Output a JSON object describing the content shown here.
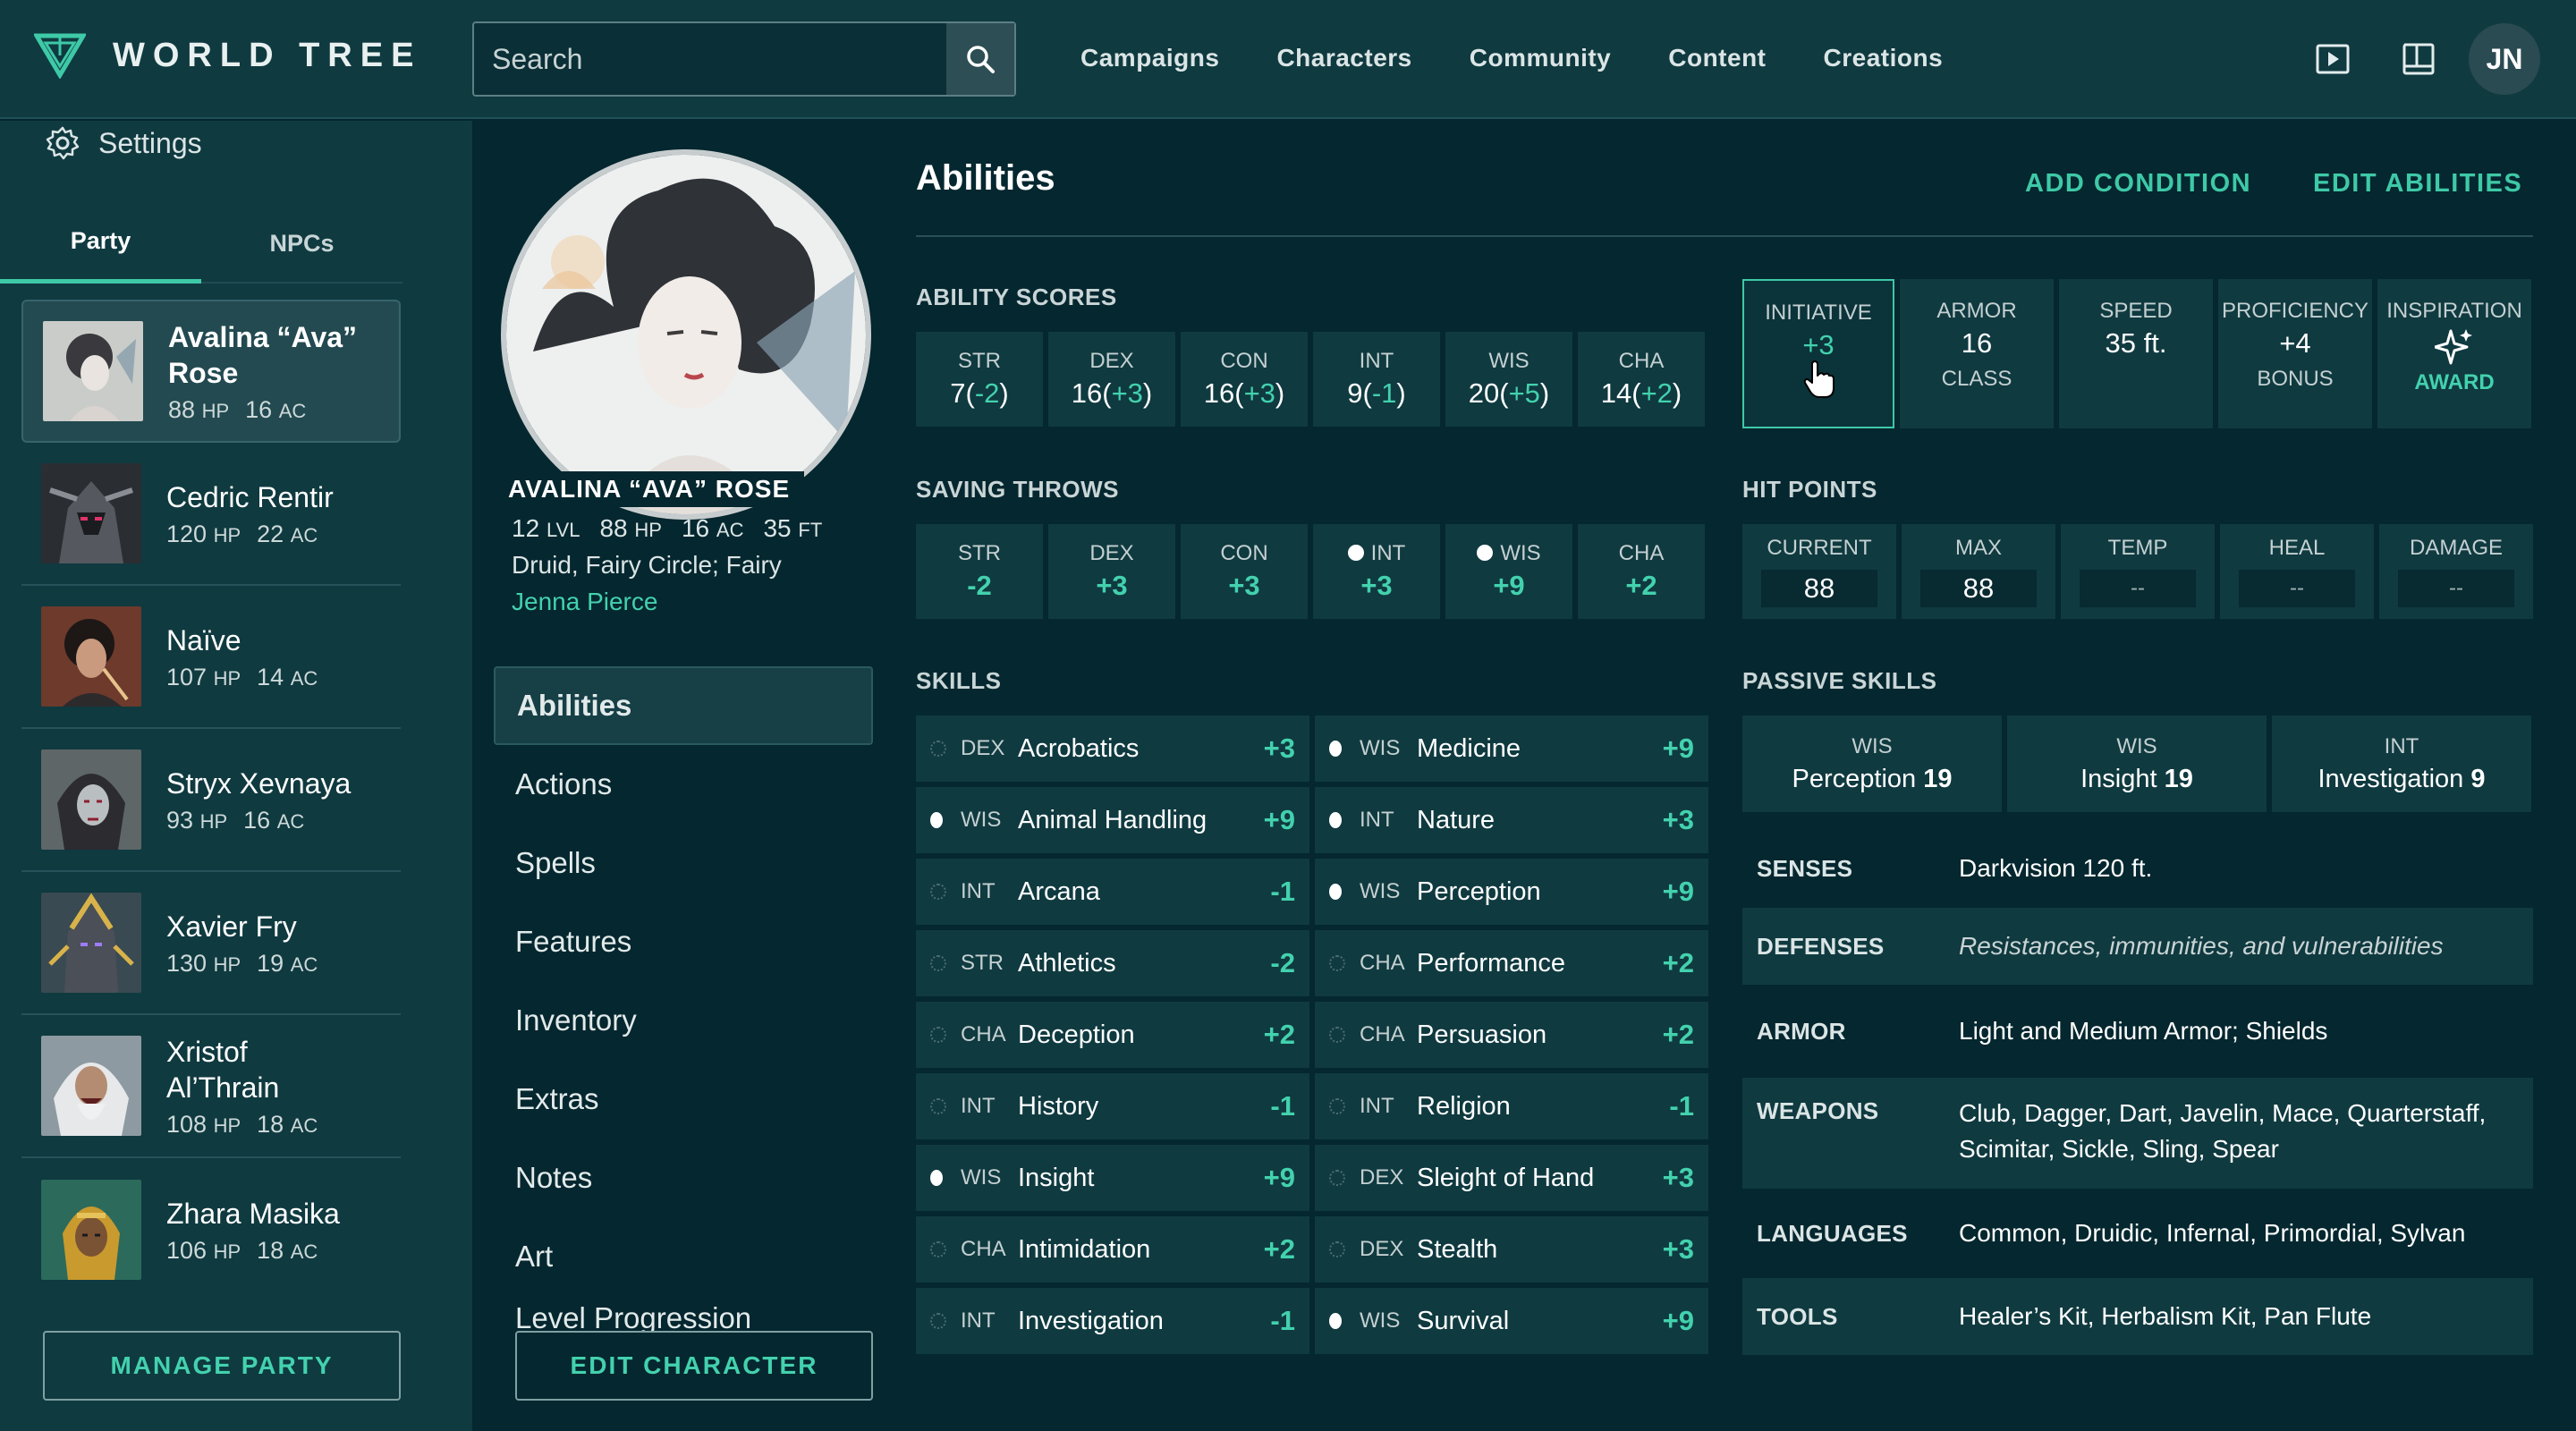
{
  "app": {
    "name": "WORLD TREE",
    "user_initials": "JN"
  },
  "search": {
    "placeholder": "Search"
  },
  "nav": [
    "Campaigns",
    "Characters",
    "Community",
    "Content",
    "Creations"
  ],
  "sidebar": {
    "settings_label": "Settings",
    "tabs": [
      "Party",
      "NPCs"
    ],
    "members": [
      {
        "name": "Avalina “Ava” Rose",
        "hp": "88",
        "ac": "16"
      },
      {
        "name": "Cedric Rentir",
        "hp": "120",
        "ac": "22"
      },
      {
        "name": "Naïve",
        "hp": "107",
        "ac": "14"
      },
      {
        "name": "Stryx Xevnaya",
        "hp": "93",
        "ac": "16"
      },
      {
        "name": "Xavier Fry",
        "hp": "130",
        "ac": "19"
      },
      {
        "name": "Xristof Al’Thrain",
        "hp": "108",
        "ac": "18"
      },
      {
        "name": "Zhara Masika",
        "hp": "106",
        "ac": "18"
      }
    ],
    "manage_party": "MANAGE PARTY",
    "units": {
      "hp": "HP",
      "ac": "AC"
    }
  },
  "character": {
    "name": "AVALINA “AVA” ROSE",
    "level": "12",
    "hp": "88",
    "ac": "16",
    "speed": "35",
    "units": {
      "lvl": "LVL",
      "hp": "HP",
      "ac": "AC",
      "ft": "FT"
    },
    "class_line": "Druid, Fairy Circle; Fairy",
    "player": "Jenna Pierce",
    "menu": [
      "Abilities",
      "Actions",
      "Spells",
      "Features",
      "Inventory",
      "Extras",
      "Notes",
      "Art",
      "Level Progression"
    ],
    "edit_button": "EDIT CHARACTER"
  },
  "abilities_panel": {
    "title": "Abilities",
    "add_condition": "ADD CONDITION",
    "edit_abilities": "EDIT ABILITIES",
    "ability_scores_label": "ABILITY SCORES",
    "ability_scores": [
      {
        "abbr": "STR",
        "score": "7",
        "mod": "-2"
      },
      {
        "abbr": "DEX",
        "score": "16",
        "mod": "+3"
      },
      {
        "abbr": "CON",
        "score": "16",
        "mod": "+3"
      },
      {
        "abbr": "INT",
        "score": "9",
        "mod": "-1"
      },
      {
        "abbr": "WIS",
        "score": "20",
        "mod": "+5"
      },
      {
        "abbr": "CHA",
        "score": "14",
        "mod": "+2"
      }
    ],
    "stats": [
      {
        "label": "INITIATIVE",
        "value": "+3",
        "sub": ""
      },
      {
        "label": "ARMOR",
        "value": "16",
        "sub": "CLASS"
      },
      {
        "label": "SPEED",
        "value": "35 ft.",
        "sub": ""
      },
      {
        "label": "PROFICIENCY",
        "value": "+4",
        "sub": "BONUS"
      },
      {
        "label": "INSPIRATION",
        "value": "",
        "sub": "AWARD"
      }
    ],
    "saving_throws_label": "SAVING THROWS",
    "saving_throws": [
      {
        "abbr": "STR",
        "mod": "-2",
        "proficient": false
      },
      {
        "abbr": "DEX",
        "mod": "+3",
        "proficient": false
      },
      {
        "abbr": "CON",
        "mod": "+3",
        "proficient": false
      },
      {
        "abbr": "INT",
        "mod": "+3",
        "proficient": true
      },
      {
        "abbr": "WIS",
        "mod": "+9",
        "proficient": true
      },
      {
        "abbr": "CHA",
        "mod": "+2",
        "proficient": false
      }
    ],
    "hit_points_label": "HIT POINTS",
    "hit_points": [
      {
        "label": "CURRENT",
        "value": "88"
      },
      {
        "label": "MAX",
        "value": "88"
      },
      {
        "label": "TEMP",
        "value": "--"
      },
      {
        "label": "HEAL",
        "value": "--"
      },
      {
        "label": "DAMAGE",
        "value": "--"
      }
    ],
    "skills_label": "SKILLS",
    "skills": [
      {
        "ability": "DEX",
        "name": "Acrobatics",
        "mod": "+3",
        "proficient": false
      },
      {
        "ability": "WIS",
        "name": "Medicine",
        "mod": "+9",
        "proficient": true
      },
      {
        "ability": "WIS",
        "name": "Animal Handling",
        "mod": "+9",
        "proficient": true
      },
      {
        "ability": "INT",
        "name": "Nature",
        "mod": "+3",
        "proficient": true
      },
      {
        "ability": "INT",
        "name": "Arcana",
        "mod": "-1",
        "proficient": false
      },
      {
        "ability": "WIS",
        "name": "Perception",
        "mod": "+9",
        "proficient": true
      },
      {
        "ability": "STR",
        "name": "Athletics",
        "mod": "-2",
        "proficient": false
      },
      {
        "ability": "CHA",
        "name": "Performance",
        "mod": "+2",
        "proficient": false
      },
      {
        "ability": "CHA",
        "name": "Deception",
        "mod": "+2",
        "proficient": false
      },
      {
        "ability": "CHA",
        "name": "Persuasion",
        "mod": "+2",
        "proficient": false
      },
      {
        "ability": "INT",
        "name": "History",
        "mod": "-1",
        "proficient": false
      },
      {
        "ability": "INT",
        "name": "Religion",
        "mod": "-1",
        "proficient": false
      },
      {
        "ability": "WIS",
        "name": "Insight",
        "mod": "+9",
        "proficient": true
      },
      {
        "ability": "DEX",
        "name": "Sleight of Hand",
        "mod": "+3",
        "proficient": false
      },
      {
        "ability": "CHA",
        "name": "Intimidation",
        "mod": "+2",
        "proficient": false
      },
      {
        "ability": "DEX",
        "name": "Stealth",
        "mod": "+3",
        "proficient": false
      },
      {
        "ability": "INT",
        "name": "Investigation",
        "mod": "-1",
        "proficient": false
      },
      {
        "ability": "WIS",
        "name": "Survival",
        "mod": "+9",
        "proficient": true
      }
    ],
    "passive_label": "PASSIVE SKILLS",
    "passive": [
      {
        "ability": "WIS",
        "name": "Perception",
        "value": "19"
      },
      {
        "ability": "WIS",
        "name": "Insight",
        "value": "19"
      },
      {
        "ability": "INT",
        "name": "Investigation",
        "value": "9"
      }
    ],
    "proficiencies": [
      {
        "key": "SENSES",
        "value": "Darkvision 120 ft.",
        "placeholder": false
      },
      {
        "key": "DEFENSES",
        "value": "Resistances, immunities, and vulnerabilities",
        "placeholder": true
      },
      {
        "key": "ARMOR",
        "value": "Light and Medium Armor; Shields",
        "placeholder": false
      },
      {
        "key": "WEAPONS",
        "value": "Club, Dagger, Dart, Javelin, Mace, Quarterstaff, Scimitar, Sickle, Sling, Spear",
        "placeholder": false
      },
      {
        "key": "LANGUAGES",
        "value": "Common, Druidic, Infernal, Primordial, Sylvan",
        "placeholder": false
      },
      {
        "key": "TOOLS",
        "value": "Healer’s Kit, Herbalism Kit, Pan Flute",
        "placeholder": false
      }
    ]
  },
  "colors": {
    "accent": "#3ec9a7",
    "background": "#05272f",
    "panel": "#0f3a40"
  }
}
